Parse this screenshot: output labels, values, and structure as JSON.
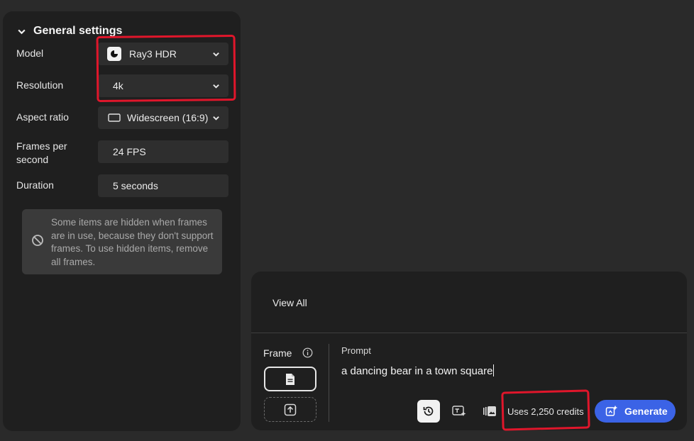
{
  "general_settings": {
    "title": "General settings",
    "model": {
      "label": "Model",
      "value": "Ray3 HDR"
    },
    "resolution": {
      "label": "Resolution",
      "value": "4k"
    },
    "aspect_ratio": {
      "label": "Aspect ratio",
      "value": "Widescreen (16:9)"
    },
    "fps": {
      "label_line1": "Frames per",
      "label_line2": "second",
      "value": "24 FPS"
    },
    "duration": {
      "label": "Duration",
      "value": "5 seconds"
    },
    "notice": "Some items are hidden when frames are in use, because they don't support frames. To use hidden items, remove all frames."
  },
  "prompt_panel": {
    "view_all": "View All",
    "frame_label": "Frame",
    "prompt_label": "Prompt",
    "prompt_text": "a dancing bear in a town square",
    "credits": "Uses 2,250 credits",
    "generate_label": "Generate"
  },
  "colors": {
    "annotation": "#e0162b",
    "generate": "#3b63e6",
    "panel": "#1f1f1f",
    "background": "#2a2a2a"
  },
  "icons": [
    "chevron-down-icon",
    "model-logo-icon",
    "widescreen-icon",
    "ban-icon",
    "info-icon",
    "document-icon",
    "upload-icon",
    "history-icon",
    "text-style-icon",
    "style-reference-icon",
    "generate-sparkle-icon"
  ]
}
